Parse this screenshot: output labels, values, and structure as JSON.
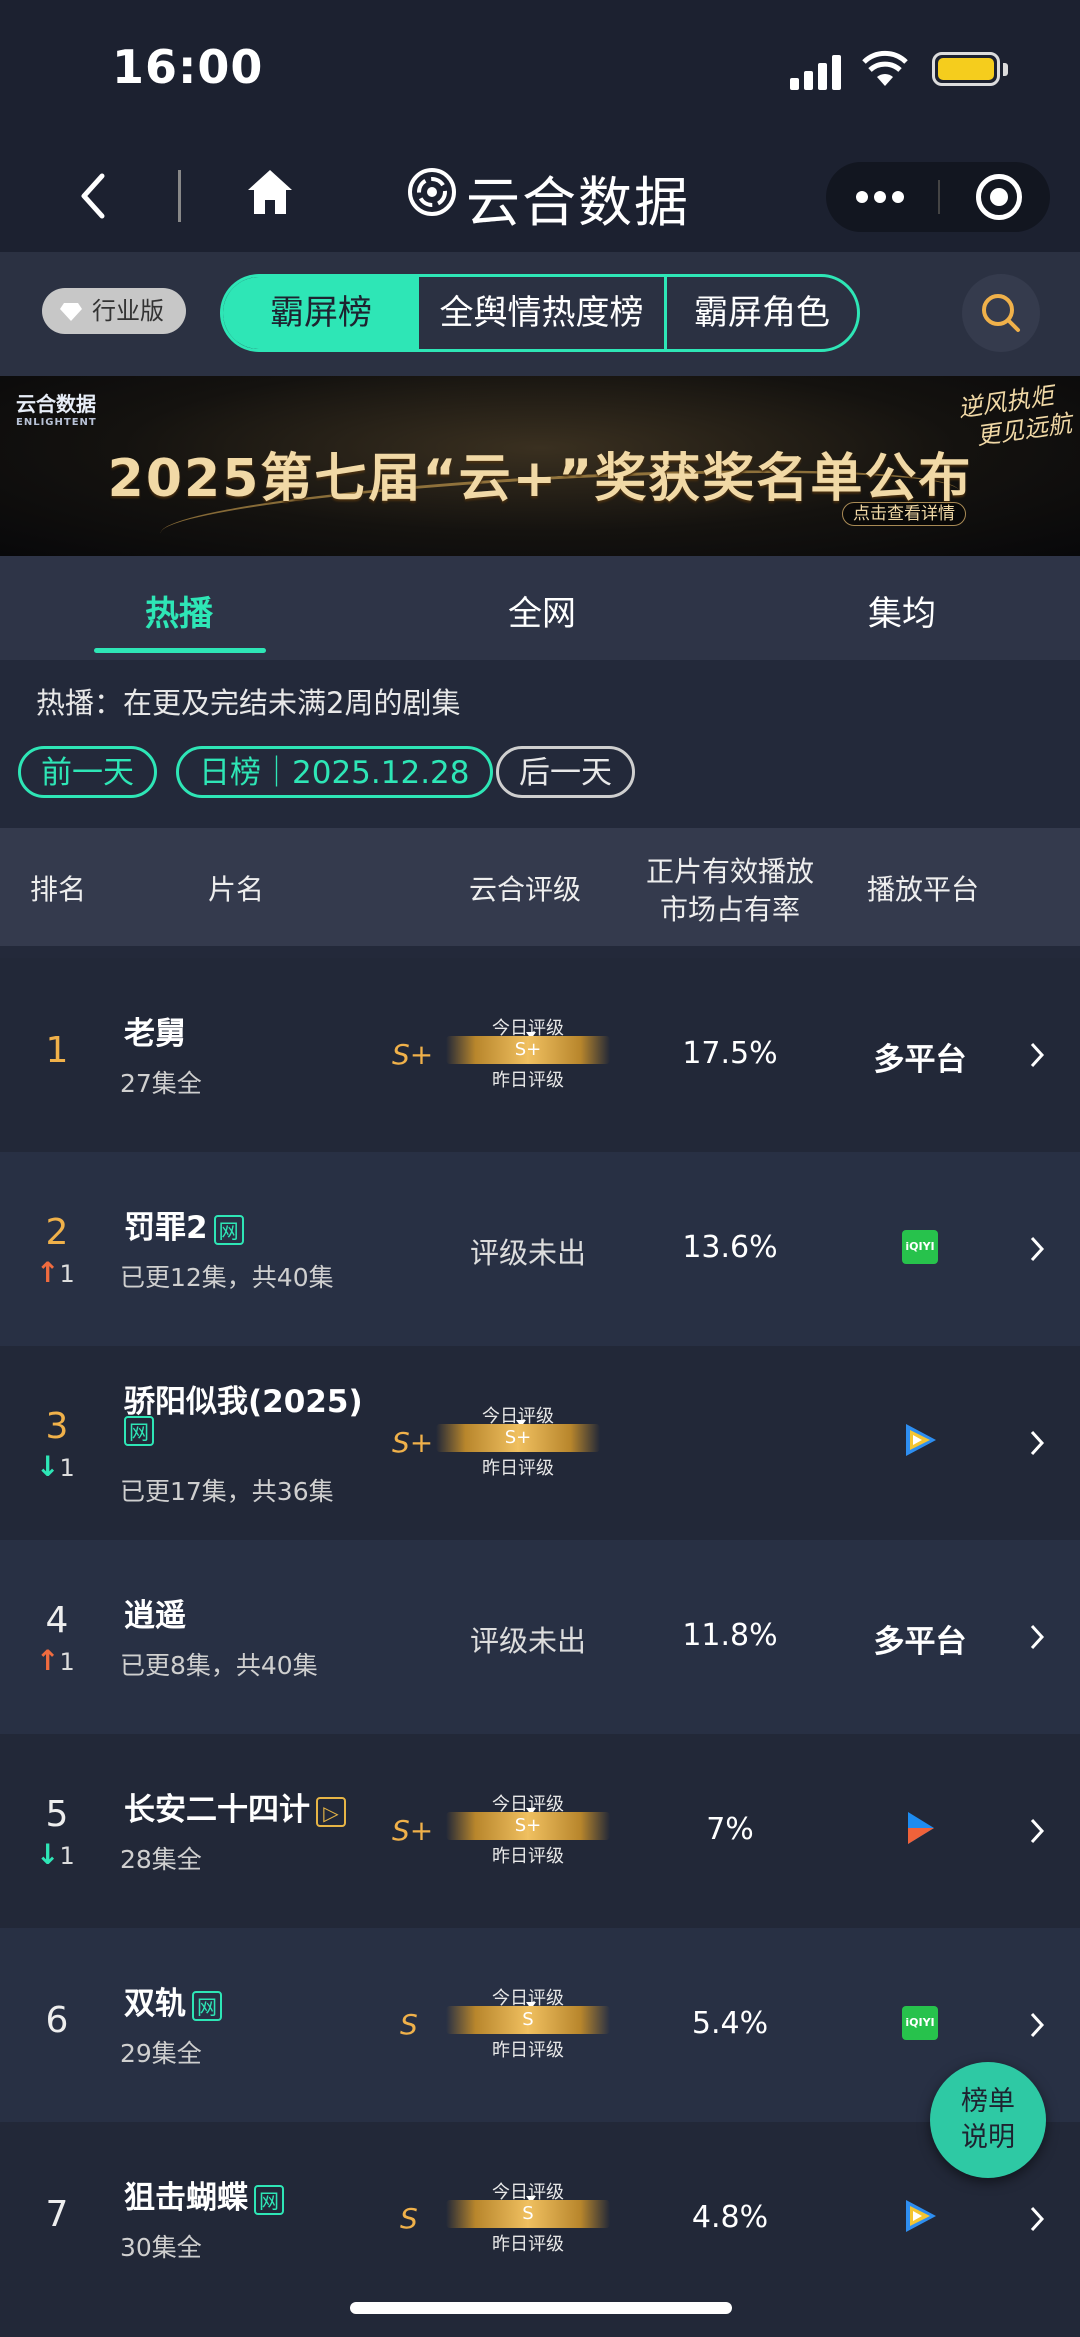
{
  "status": {
    "time": "16:00"
  },
  "nav": {
    "title": "云合数据"
  },
  "toolbar": {
    "edition": "行业版",
    "segments": [
      "霸屏榜",
      "全舆情热度榜",
      "霸屏角色"
    ]
  },
  "banner": {
    "logo": "云合数据",
    "logo_en": "ENLIGHTENT",
    "headline": "2025第七届“云+”奖获奖名单公布",
    "calligraphy": [
      "逆风执炬",
      "更见远航"
    ],
    "detail": "点击查看详情"
  },
  "subtabs": [
    "热播",
    "全网",
    "集均"
  ],
  "description": "热播：在更及完结未满2周的剧集",
  "date_nav": {
    "prev": "前一天",
    "current": "日榜｜2025.12.28",
    "next": "后一天"
  },
  "table": {
    "headers": [
      "排名",
      "片名",
      "云合评级",
      "正片有效播放",
      "市场占有率",
      "播放平台"
    ],
    "today_label": "今日评级",
    "yesterday_label": "昨日评级",
    "rows": [
      {
        "rank": "1",
        "move": "",
        "title": "老舅",
        "tag": "",
        "sub": "27集全",
        "grade": "S+",
        "gauge": "S+",
        "grade_text": "",
        "share": "17.5%",
        "platform": "多平台"
      },
      {
        "rank": "2",
        "move": "1",
        "title": "罚罪2",
        "tag": "网",
        "sub": "已更12集，共40集",
        "grade": "",
        "gauge": "",
        "grade_text": "评级未出",
        "share": "13.6%",
        "platform": "iQIYI"
      },
      {
        "rank": "3",
        "move": "1",
        "title": "骄阳似我(2025)",
        "tag": "网",
        "sub": "已更17集，共36集",
        "grade": "S+",
        "gauge": "S+",
        "grade_text": "",
        "share": "",
        "platform": "tencent"
      },
      {
        "rank": "4",
        "move": "1",
        "title": "逍遥",
        "tag": "",
        "sub": "已更8集，共40集",
        "grade": "",
        "gauge": "",
        "grade_text": "评级未出",
        "share": "11.8%",
        "platform": "多平台"
      },
      {
        "rank": "5",
        "move": "1",
        "title": "长安二十四计",
        "tag": "▷",
        "sub": "28集全",
        "grade": "S+",
        "gauge": "S+",
        "grade_text": "",
        "share": "7%",
        "platform": "youku"
      },
      {
        "rank": "6",
        "move": "",
        "title": "双轨",
        "tag": "网",
        "sub": "29集全",
        "grade": "S",
        "gauge": "S",
        "grade_text": "",
        "share": "5.4%",
        "platform": "iQIYI"
      },
      {
        "rank": "7",
        "move": "",
        "title": "狙击蝴蝶",
        "tag": "网",
        "sub": "30集全",
        "grade": "S",
        "gauge": "S",
        "grade_text": "",
        "share": "4.8%",
        "platform": "tencent"
      }
    ]
  },
  "help_button": [
    "榜单",
    "说明"
  ],
  "iqiyi_logo": "iQIYI",
  "colors": {
    "accent": "#2ee6b6",
    "gold": "#f0b14a",
    "up": "#f06b3f",
    "bg": "#23293a"
  }
}
